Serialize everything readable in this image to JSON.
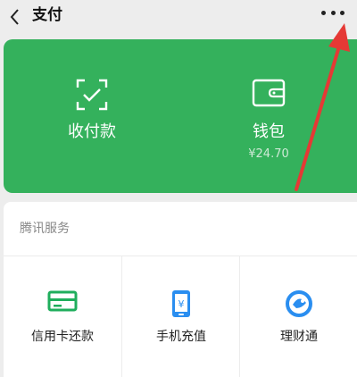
{
  "header": {
    "title": "支付"
  },
  "green_card": {
    "items": [
      {
        "label": "收付款",
        "icon": "scan-qr-icon"
      },
      {
        "label": "钱包",
        "sub": "¥24.70",
        "icon": "wallet-icon"
      }
    ]
  },
  "services": {
    "header": "腾讯服务",
    "items": [
      {
        "label": "信用卡还款",
        "icon": "credit-card-icon"
      },
      {
        "label": "手机充值",
        "icon": "phone-topup-icon"
      },
      {
        "label": "理财通",
        "icon": "wealth-icon"
      }
    ]
  },
  "colors": {
    "brand_green": "#34b15c",
    "annotation_red": "#e53935"
  }
}
